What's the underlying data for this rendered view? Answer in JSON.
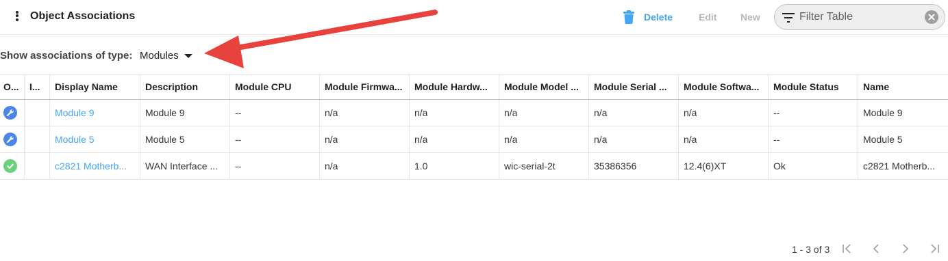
{
  "header": {
    "title": "Object Associations",
    "delete_label": "Delete",
    "edit_label": "Edit",
    "new_label": "New",
    "filter_placeholder": "Filter Table",
    "accent_color": "#42a5f5"
  },
  "type_selector": {
    "label": "Show associations of type:",
    "value": "Modules"
  },
  "table": {
    "columns": [
      "O...",
      "I...",
      "Display Name",
      "Description",
      "Module CPU",
      "Module Firmwa...",
      "Module Hardw...",
      "Module Model ...",
      "Module Serial ...",
      "Module Softwa...",
      "Module Status",
      "Name"
    ],
    "rows": [
      {
        "status_icon": "wrench-icon",
        "i": "",
        "display_name": "Module 9",
        "description": "Module 9",
        "cpu": "--",
        "firmware": "n/a",
        "hardware": "n/a",
        "model": "n/a",
        "serial": "n/a",
        "software": "n/a",
        "status": "--",
        "name": "Module 9"
      },
      {
        "status_icon": "wrench-icon",
        "i": "",
        "display_name": "Module 5",
        "description": "Module 5",
        "cpu": "--",
        "firmware": "n/a",
        "hardware": "n/a",
        "model": "n/a",
        "serial": "n/a",
        "software": "n/a",
        "status": "--",
        "name": "Module 5"
      },
      {
        "status_icon": "check-circle-icon",
        "i": "",
        "display_name": "c2821 Motherb...",
        "description": "WAN Interface ...",
        "cpu": "--",
        "firmware": "n/a",
        "hardware": "1.0",
        "model": "wic-serial-2t",
        "serial": "35386356",
        "software": "12.4(6)XT",
        "status": "Ok",
        "name": "c2821 Motherb..."
      }
    ]
  },
  "pagination": {
    "range_text": "1 - 3 of 3"
  },
  "annotation": {
    "arrow_color": "#e8423f"
  }
}
